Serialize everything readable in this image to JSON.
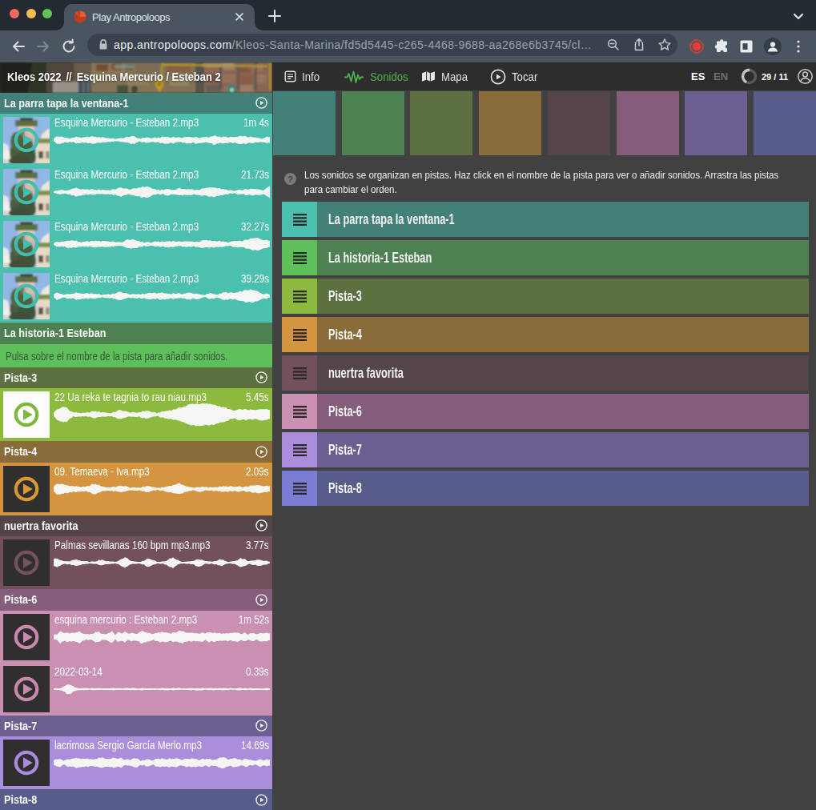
{
  "window": {
    "tab_title": "Play Antropoloops",
    "url_host": "app.antropoloops.com",
    "url_path": "/Kleos-Santa-Marina/fd5d5445-c265-4468-9688-aa268e6b3745/cl…"
  },
  "header": {
    "project": "Kleos 2022",
    "separator": "//",
    "session": "Esquina Mercurio / Esteban 2",
    "accent": "#4CAF50",
    "nav": [
      {
        "id": "info",
        "label": "Info",
        "active": false
      },
      {
        "id": "sonidos",
        "label": "Sonidos",
        "active": true
      },
      {
        "id": "mapa",
        "label": "Mapa",
        "active": false
      },
      {
        "id": "tocar",
        "label": "Tocar",
        "active": false
      }
    ],
    "languages": [
      {
        "label": "ES",
        "active": true
      },
      {
        "label": "EN",
        "active": false
      }
    ],
    "counter": "29 / 11"
  },
  "help": {
    "icon_glyph": "?",
    "lines": [
      "Los sonidos se organizan en pistas. Haz click en el nombre de la pista para ver o añadir sonidos. Arrastra las pistas",
      "para cambiar el orden."
    ]
  },
  "tracks": [
    {
      "name": "La parra tapa la ventana-1",
      "dark": "#428078",
      "bright": "#4CC0AF",
      "ring": "#3FBFAC",
      "header_play": true,
      "thumb": "photo",
      "clips": [
        {
          "file": "Esquina Mercurio - Esteban 2.mp3",
          "duration": "1m 4s",
          "wave": [
            1.9,
            4.4,
            4.5,
            3.4,
            2.7,
            2.5,
            2.7,
            3.9,
            3.6,
            2.7,
            3.4,
            4.3,
            4.5,
            3.9,
            3.5,
            3.9,
            3.0,
            2.3,
            2.0,
            1.6,
            1.7,
            2.4,
            3.1,
            3.9,
            4.8,
            4.3,
            2.5,
            1.9,
            3.0,
            3.3,
            2.6,
            2.5,
            3.1,
            3.2,
            4.3,
            4.2,
            3.4,
            4.0,
            3.5,
            2.9,
            3.4,
            4.0,
            3.7,
            3.4,
            4.2,
            3.1,
            2.9,
            3.8,
            3.3,
            4.7,
            5.9,
            4.4,
            3.7,
            4.0,
            3.6,
            3.5,
            3.6,
            3.8,
            5.0,
            4.7,
            4.0,
            3.8,
            3.3,
            2.8,
            2.3,
            2.8,
            3.6,
            4.2
          ]
        },
        {
          "file": "Esquina Mercurio - Esteban 2.mp3",
          "duration": "21.73s",
          "wave": [
            1.4,
            1.8,
            2.7,
            2.2,
            1.9,
            3.1,
            4.4,
            5.1,
            4.2,
            3.2,
            2.8,
            3.5,
            3.3,
            2.5,
            2.8,
            2.9,
            2.7,
            2.4,
            2.8,
            3.7,
            4.9,
            5.5,
            4.4,
            3.8,
            3.5,
            4.1,
            5.2,
            6.2,
            6.6,
            6.7,
            5.7,
            3.4,
            2.9,
            2.7,
            2.6,
            4.0,
            3.6,
            2.6,
            3.6,
            4.5,
            4.3,
            3.5,
            3.4,
            3.5,
            2.8,
            3.0,
            4.2,
            4.7,
            5.6,
            5.9,
            5.7,
            5.2,
            3.9,
            3.0,
            2.6,
            1.9,
            1.4,
            2.5,
            2.3,
            3.0,
            3.6,
            3.8,
            3.8,
            3.3,
            3.4,
            2.6,
            4.7,
            8.4
          ]
        },
        {
          "file": "Esquina Mercurio - Esteban 2.mp3",
          "duration": "32.27s",
          "wave": [
            1.5,
            2.9,
            2.9,
            2.8,
            3.9,
            4.7,
            4.4,
            3.9,
            3.0,
            2.4,
            3.1,
            3.5,
            3.5,
            4.0,
            3.7,
            3.9,
            3.9,
            3.5,
            3.1,
            2.8,
            2.3,
            2.1,
            4.1,
            5.8,
            5.6,
            4.9,
            4.4,
            3.1,
            2.3,
            2.6,
            1.9,
            2.5,
            3.4,
            3.1,
            3.0,
            3.5,
            3.9,
            3.8,
            3.5,
            2.8,
            3.6,
            3.6,
            3.0,
            3.2,
            3.0,
            3.1,
            4.2,
            4.8,
            4.4,
            4.0,
            4.0,
            4.0,
            3.5,
            2.9,
            2.1,
            2.8,
            3.9,
            3.5,
            3.5,
            4.4,
            5.5,
            6.8,
            7.2,
            7.8,
            6.8,
            5.3,
            4.9,
            4.2
          ]
        },
        {
          "file": "Esquina Mercurio - Esteban 2.mp3",
          "duration": "39.29s",
          "wave": [
            2.3,
            4.4,
            3.1,
            1.6,
            2.5,
            2.9,
            2.8,
            4.2,
            3.9,
            2.6,
            3.0,
            3.5,
            2.9,
            2.8,
            2.5,
            1.8,
            2.2,
            2.5,
            2.2,
            3.5,
            4.9,
            4.9,
            3.9,
            2.8,
            2.3,
            2.1,
            2.6,
            2.6,
            2.7,
            3.3,
            4.2,
            3.6,
            3.5,
            4.4,
            4.1,
            3.4,
            2.8,
            3.5,
            3.4,
            3.0,
            2.9,
            3.6,
            4.2,
            3.3,
            3.3,
            3.1,
            1.4,
            1.5,
            3.3,
            3.5,
            2.4,
            2.2,
            3.6,
            4.6,
            4.4,
            4.2,
            3.9,
            4.5,
            5.7,
            6.9,
            7.5,
            8.0,
            7.3,
            6.1,
            4.4,
            2.9,
            3.1,
            2.4
          ]
        }
      ]
    },
    {
      "name": "La historia-1 Esteban",
      "dark": "#4E8151",
      "bright": "#5EC05A",
      "ring": "#5EC05A",
      "header_play": false,
      "thumb": "dark",
      "empty_text": "Pulsa sobre el nombre de la pista para añadir sonidos.",
      "clips": []
    },
    {
      "name": "Pista-3",
      "dark": "#5D7140",
      "bright": "#8BBA3E",
      "ring": "#7EB83B",
      "header_play": true,
      "thumb": "white",
      "clips": [
        {
          "file": "22 Ua reka te tagnia to rau niau.mp3",
          "duration": "5.45s",
          "wave": [
            2.5,
            6.2,
            8.0,
            9.4,
            8.9,
            5.0,
            2.7,
            2.7,
            2.3,
            1.9,
            2.0,
            2.9,
            3.9,
            4.2,
            3.3,
            3.2,
            2.8,
            2.0,
            1.9,
            3.5,
            5.4,
            5.2,
            4.4,
            3.3,
            2.6,
            2.4,
            2.5,
            3.3,
            4.6,
            4.9,
            3.7,
            2.6,
            2.0,
            3.1,
            4.1,
            4.6,
            5.5,
            6.2,
            7.1,
            8.6,
            9.6,
            10.7,
            12.5,
            13.5,
            13.5,
            13.5,
            13.5,
            13.5,
            13.5,
            12.9,
            12.3,
            10.9,
            9.5,
            8.9,
            7.7,
            5.6,
            4.8,
            6.1,
            6.6,
            6.4,
            6.2,
            6.1,
            5.8,
            5.5,
            7.1,
            7.3,
            6.4,
            6.0
          ]
        }
      ]
    },
    {
      "name": "Pista-4",
      "dark": "#8A6B3A",
      "bright": "#D59540",
      "ring": "#D89934",
      "header_play": true,
      "thumb": "dark",
      "clips": [
        {
          "file": "09. Temaeva - Iva.mp3",
          "duration": "2.09s",
          "wave": [
            3.4,
            6.5,
            6.3,
            5.6,
            4.8,
            4.2,
            3.5,
            3.3,
            3.0,
            2.4,
            2.6,
            4.2,
            5.9,
            6.1,
            4.8,
            3.5,
            2.4,
            2.1,
            2.4,
            2.9,
            3.4,
            4.1,
            3.7,
            2.6,
            1.7,
            1.7,
            1.9,
            1.8,
            3.1,
            3.9,
            3.2,
            1.9,
            1.5,
            1.7,
            2.1,
            3.2,
            4.0,
            4.8,
            6.2,
            6.7,
            5.6,
            3.4,
            2.3,
            1.8,
            2.0,
            2.7,
            2.6,
            2.2,
            2.0,
            2.2,
            2.3,
            2.8,
            3.2,
            3.1,
            3.3,
            3.1,
            2.6,
            2.9,
            2.6,
            2.3,
            3.3,
            4.0,
            4.2,
            4.6,
            4.9,
            4.1,
            3.6,
            3.9
          ]
        }
      ]
    },
    {
      "name": "nuertra favorita",
      "dark": "#544648",
      "bright": "#72515A",
      "ring": "#75525C",
      "header_play": true,
      "thumb": "dark",
      "clips": [
        {
          "file": "Palmas sevillanas 160 bpm mp3.mp3",
          "duration": "3.77s",
          "wave": [
            5.0,
            5.1,
            3.5,
            1.8,
            1.7,
            1.9,
            3.4,
            3.7,
            3.1,
            1.5,
            1.7,
            1.1,
            1.4,
            1.4,
            3.1,
            4.0,
            2.1,
            1.8,
            1.4,
            1.1,
            1.8,
            4.2,
            6.8,
            4.9,
            2.0,
            1.3,
            1.1,
            1.2,
            2.6,
            5.1,
            4.4,
            2.6,
            1.3,
            1.1,
            1.6,
            2.2,
            5.5,
            6.5,
            4.2,
            1.8,
            1.2,
            1.4,
            1.3,
            2.0,
            3.6,
            4.5,
            3.2,
            1.7,
            1.6,
            1.2,
            2.1,
            3.4,
            4.2,
            2.1,
            1.0,
            1.3,
            1.9,
            2.9,
            5.3,
            4.6,
            2.2,
            2.0,
            2.5,
            3.4,
            3.9,
            2.8,
            2.1,
            1.3
          ]
        }
      ]
    },
    {
      "name": "Pista-6",
      "dark": "#865C7C",
      "bright": "#CA90B2",
      "ring": "#C989AE",
      "header_play": true,
      "thumb": "dark",
      "clips": [
        {
          "file": "esquina mercurio : Esteban 2.mp3",
          "duration": "1m 52s",
          "wave": [
            3.6,
            3.0,
            7.6,
            4.8,
            5.5,
            5.2,
            5.4,
            5.3,
            7.7,
            3.9,
            3.2,
            3.9,
            3.5,
            6.3,
            6.4,
            4.1,
            3.6,
            4.9,
            7.2,
            3.0,
            6.2,
            4.2,
            7.0,
            4.3,
            5.3,
            3.8,
            4.5,
            7.6,
            7.0,
            5.4,
            4.8,
            3.5,
            5.5,
            6.0,
            5.9,
            5.9,
            4.5,
            5.9,
            5.9,
            7.6,
            8.0,
            5.6,
            4.8,
            5.6,
            4.9,
            4.6,
            5.5,
            4.2,
            6.3,
            5.3,
            5.7,
            5.1,
            4.4,
            4.1,
            5.0,
            4.6,
            5.6,
            5.2,
            3.5,
            5.3,
            3.5,
            4.4,
            4.8,
            3.0,
            5.3,
            5.4,
            5.0,
            4.7
          ]
        },
        {
          "file": "2022-03-14",
          "duration": "0.39s",
          "wave": [
            1.1,
            1.0,
            1.2,
            2.4,
            5.4,
            6.2,
            3.5,
            1.5,
            1.1,
            1.0,
            1.2,
            0.9,
            1.2,
            1.1,
            1.1,
            1.1,
            1.0,
            1.1,
            1.2,
            1.2,
            1.1,
            0.9,
            1.2,
            1.2,
            1.2,
            1.1,
            0.9,
            1.2,
            1.1,
            0.9,
            1.1,
            0.9,
            0.9,
            1.0,
            1.3,
            1.1,
            1.1,
            1.3,
            1.3,
            1.1,
            1.1,
            0.9,
            1.0,
            1.2,
            1.1,
            1.1,
            1.2,
            1.0,
            1.1,
            1.2,
            1.2,
            1.2,
            1.1,
            1.1,
            1.1,
            1.0,
            0.9,
            1.2,
            1.1,
            1.1,
            0.9,
            1.1,
            1.0,
            1.0,
            0.9,
            1.1,
            1.2,
            1.1
          ]
        }
      ]
    },
    {
      "name": "Pista-7",
      "dark": "#6B5F91",
      "bright": "#AA8EDB",
      "ring": "#A98CDB",
      "header_play": true,
      "thumb": "dark",
      "clips": [
        {
          "file": "lacrimosa Sergio García Merlo.mp3",
          "duration": "14.69s",
          "wave": [
            3.5,
            4.2,
            5.0,
            2.2,
            4.1,
            4.8,
            5.0,
            6.1,
            5.5,
            4.6,
            4.6,
            5.2,
            3.9,
            4.6,
            5.9,
            7.0,
            5.0,
            5.1,
            5.3,
            6.4,
            4.7,
            6.2,
            3.4,
            4.1,
            4.0,
            5.1,
            5.4,
            2.5,
            3.2,
            4.6,
            3.5,
            2.6,
            5.4,
            4.9,
            5.0,
            4.0,
            5.8,
            4.5,
            6.1,
            4.0,
            4.1,
            5.2,
            4.2,
            5.6,
            5.0,
            3.6,
            4.6,
            4.0,
            5.3,
            3.6,
            3.8,
            5.6,
            6.7,
            6.4,
            4.3,
            4.4,
            5.9,
            4.1,
            3.1,
            4.3,
            4.7,
            3.3,
            2.4,
            2.6,
            4.9,
            3.4,
            4.0,
            4.4
          ]
        }
      ]
    },
    {
      "name": "Pista-8",
      "dark": "#585C8B",
      "bright": "#7A7DD3",
      "ring": "#7A7DD3",
      "header_play": true,
      "thumb": "dark",
      "clips": []
    }
  ]
}
